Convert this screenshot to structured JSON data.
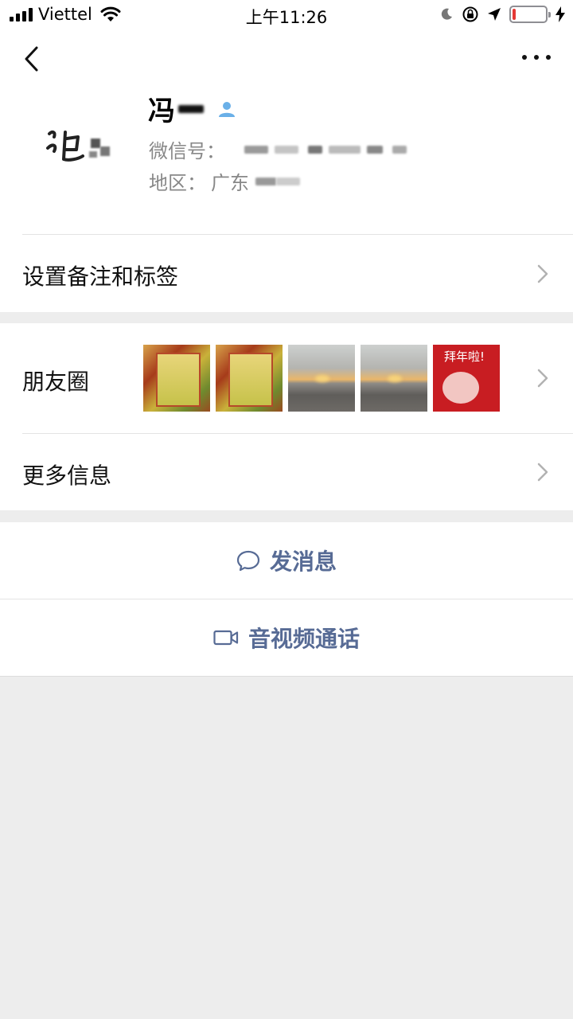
{
  "status_bar": {
    "carrier": "Viettel",
    "time": "上午11:26",
    "battery_level": 0.1
  },
  "profile": {
    "name": "冯",
    "wechat_id_label": "微信号：",
    "region_label": "地区：",
    "region_value": "广东"
  },
  "menu": {
    "remark_tags": "设置备注和标签",
    "moments": "朋友圈",
    "more_info": "更多信息"
  },
  "moments_thumbs": [
    {
      "kind": "certificate"
    },
    {
      "kind": "certificate"
    },
    {
      "kind": "sunset-sea"
    },
    {
      "kind": "sunset-sea"
    },
    {
      "kind": "new-year-pig",
      "text": "拜年啦!"
    }
  ],
  "actions": {
    "send_message": "发消息",
    "video_call": "音视频通话"
  },
  "colors": {
    "link_blue": "#576b95",
    "background": "#ededed"
  }
}
